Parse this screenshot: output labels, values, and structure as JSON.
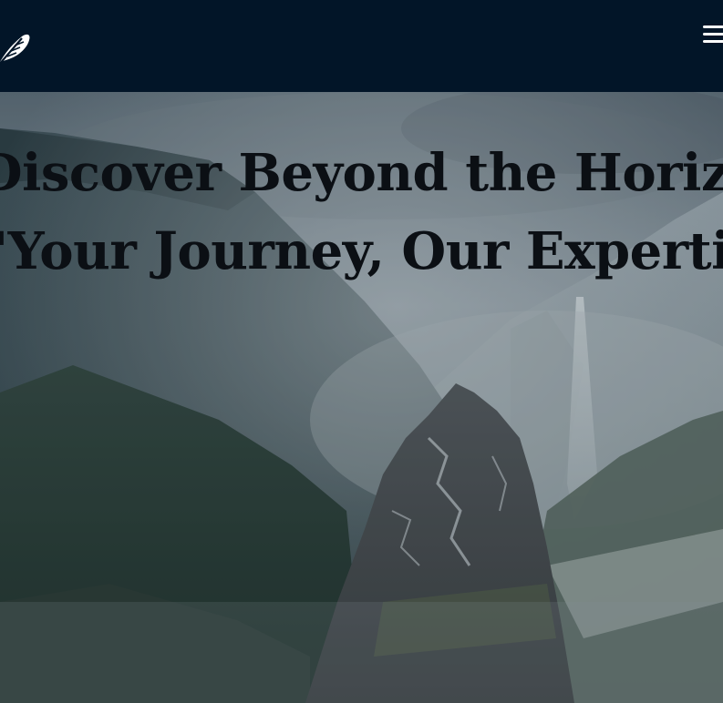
{
  "navbar": {
    "logo_icon": "feather-icon",
    "menu_icon": "hamburger-menu-icon",
    "background_color": "#021528"
  },
  "hero": {
    "headline_line1": "Discover Beyond the Horizon",
    "headline_line2": "\"Your Journey, Our Expertise\"",
    "background": "misty mountain valley with waterfall and rocky spire"
  }
}
